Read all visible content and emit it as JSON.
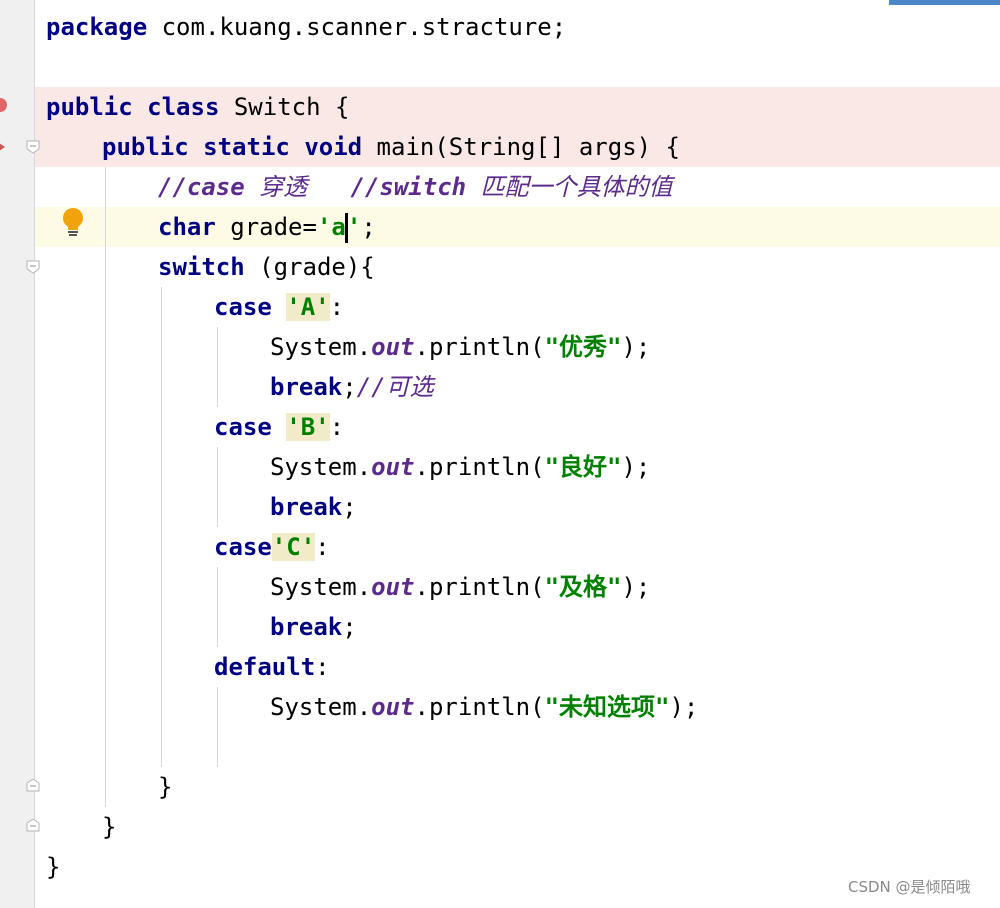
{
  "editor": {
    "lines": {
      "l1": {
        "kw": "package",
        "rest": " com.kuang.scanner.stracture;"
      },
      "l3": {
        "kw1": "public",
        "kw2": "class",
        "rest": " Switch {"
      },
      "l4": {
        "kw1": "public",
        "kw2": "static",
        "kw3": "void",
        "rest": " main(String[] args) {"
      },
      "l5": {
        "c1": "//case",
        "c2": " 穿透   ",
        "c3": "//switch",
        "c4": " 匹配一个具体的值"
      },
      "l6": {
        "kw": "char",
        "rest": " grade=",
        "q1": "'",
        "ch": "a",
        "q2": "'",
        "end": ";"
      },
      "l7": {
        "kw": "switch",
        "rest": " (grade){"
      },
      "l8": {
        "kw": "case",
        "lit": "'A'",
        "end": ":"
      },
      "l9": {
        "pre": "System.",
        "fld": "out",
        "mid": ".println(",
        "str": "\"优秀\"",
        "end": ");"
      },
      "l10": {
        "kw": "break",
        "end": ";",
        "cmt": "//可选"
      },
      "l11": {
        "kw": "case",
        "lit": "'B'",
        "end": ":"
      },
      "l12": {
        "pre": "System.",
        "fld": "out",
        "mid": ".println(",
        "str": "\"良好\"",
        "end": ");"
      },
      "l13": {
        "kw": "break",
        "end": ";"
      },
      "l14": {
        "kw": "case",
        "lit": "'C'",
        "end": ":"
      },
      "l15": {
        "pre": "System.",
        "fld": "out",
        "mid": ".println(",
        "str": "\"及格\"",
        "end": ");"
      },
      "l16": {
        "kw": "break",
        "end": ";"
      },
      "l17": {
        "kw": "default",
        "end": ":"
      },
      "l18": {
        "pre": "System.",
        "fld": "out",
        "mid": ".println(",
        "str": "\"未知选项\"",
        "end": ");"
      },
      "l20": {
        "text": "}"
      },
      "l21": {
        "text": "}"
      },
      "l22": {
        "text": "}"
      }
    }
  },
  "watermark": "CSDN @是倾陌哦",
  "colors": {
    "keyword": "#000080",
    "string": "#008000",
    "comment": "#5c2b8c",
    "breakpoint_line": "#fae8e6",
    "caret_line": "#fdfbe6",
    "gutter": "#f0f0f0"
  },
  "icons": [
    "breakpoint-icon",
    "run-arrow-icon",
    "lightbulb-icon",
    "fold-icon"
  ]
}
